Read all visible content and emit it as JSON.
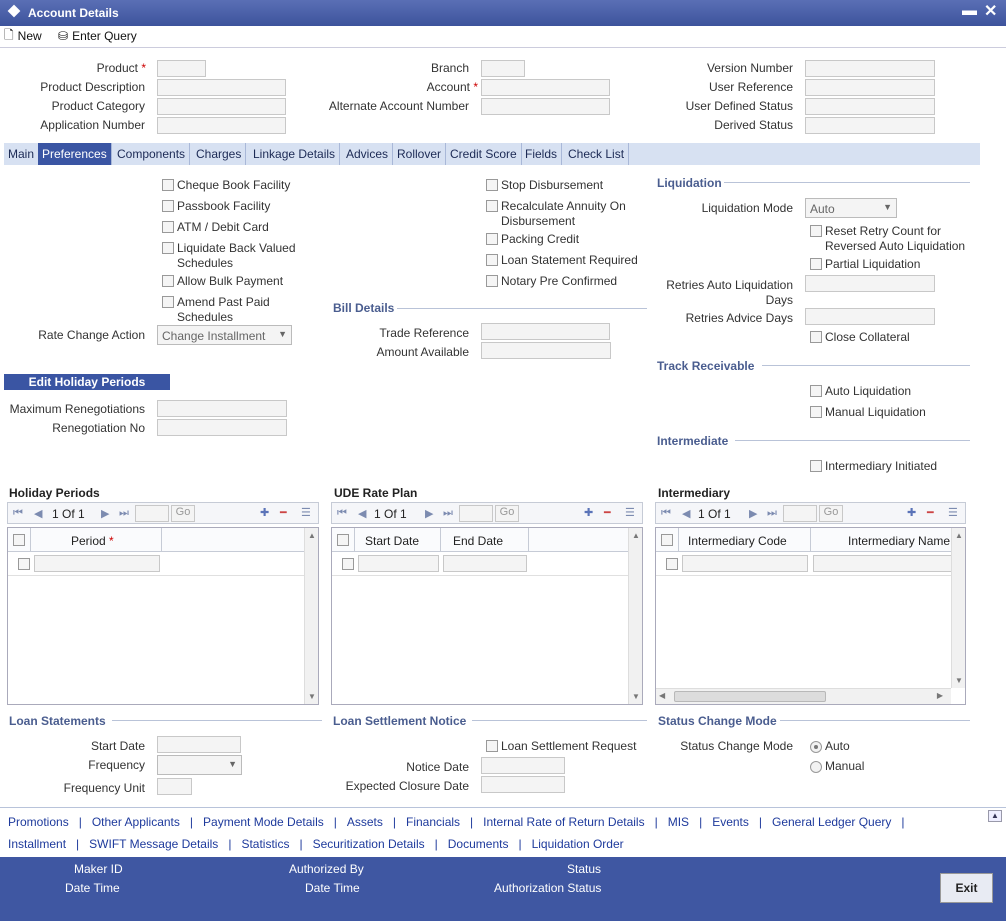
{
  "window": {
    "title": "Account Details"
  },
  "toolbar": {
    "new_label": "New",
    "enter_query_label": "Enter Query"
  },
  "header": {
    "product": "Product",
    "product_description": "Product Description",
    "product_category": "Product Category",
    "application_number": "Application Number",
    "branch": "Branch",
    "account": "Account",
    "alternate_account_number": "Alternate Account Number",
    "version_number": "Version Number",
    "user_reference": "User Reference",
    "user_defined_status": "User Defined Status",
    "derived_status": "Derived Status",
    "required_mark": "*"
  },
  "tabs": [
    "Main",
    "Preferences",
    "Components",
    "Charges",
    "Linkage Details",
    "Advices",
    "Rollover",
    "Credit Score",
    "Fields",
    "Check List"
  ],
  "prefs": {
    "col1": [
      "Cheque Book Facility",
      "Passbook Facility",
      "ATM / Debit Card",
      "Liquidate Back Valued",
      "Schedules",
      "Allow Bulk Payment",
      "Amend Past Paid",
      "Schedules"
    ],
    "rate_change_action_label": "Rate Change Action",
    "rate_change_action_value": "Change Installment",
    "col2": [
      "Stop Disbursement",
      "Recalculate Annuity On",
      "Disbursement",
      "Packing Credit",
      "Loan Statement Required",
      "Notary Pre Confirmed"
    ],
    "bill_details": "Bill Details",
    "trade_reference": "Trade Reference",
    "amount_available": "Amount Available",
    "edit_holiday_periods": "Edit Holiday Periods",
    "maximum_renegotiations": "Maximum Renegotiations",
    "renegotiation_no": "Renegotiation No"
  },
  "liquidation": {
    "title": "Liquidation",
    "mode_label": "Liquidation Mode",
    "mode_value": "Auto",
    "reset_retry": "Reset Retry Count for",
    "reversed_auto": "Reversed Auto Liquidation",
    "partial": "Partial Liquidation",
    "retries_auto": "Retries Auto Liquidation",
    "days": "Days",
    "retries_advice": "Retries Advice Days",
    "close_collateral": "Close Collateral"
  },
  "track": {
    "title": "Track Receivable",
    "auto": "Auto Liquidation",
    "manual": "Manual Liquidation"
  },
  "intermediate": {
    "title": "Intermediate",
    "initiated": "Intermediary Initiated"
  },
  "grids": {
    "holiday": {
      "title": "Holiday Periods",
      "page": "1 Of 1",
      "go": "Go",
      "col1": "Period"
    },
    "ude": {
      "title": "UDE Rate Plan",
      "page": "1 Of 1",
      "go": "Go",
      "col1": "Start Date",
      "col2": "End Date"
    },
    "inter": {
      "title": "Intermediary",
      "page": "1 Of 1",
      "go": "Go",
      "col1": "Intermediary Code",
      "col2": "Intermediary Name"
    }
  },
  "loan_statements": {
    "title": "Loan Statements",
    "start_date": "Start Date",
    "frequency": "Frequency",
    "frequency_unit": "Frequency Unit"
  },
  "settlement": {
    "title": "Loan Settlement Notice",
    "request": "Loan Settlement Request",
    "notice_date": "Notice Date",
    "expected_closure": "Expected Closure Date"
  },
  "status_change": {
    "title": "Status Change Mode",
    "label": "Status Change Mode",
    "auto": "Auto",
    "manual": "Manual"
  },
  "links_row1": [
    "Promotions",
    "Other Applicants",
    "Payment Mode Details",
    "Assets",
    "Financials",
    "Internal Rate of Return Details",
    "MIS",
    "Events",
    "General Ledger Query"
  ],
  "links_row2": [
    "Installment",
    "SWIFT Message Details",
    "Statistics",
    "Securitization Details",
    "Documents",
    "Liquidation Order"
  ],
  "link_separator": "|",
  "footer": {
    "maker_id": "Maker ID",
    "date_time": "Date Time",
    "authorized_by": "Authorized By",
    "date_time2": "Date Time",
    "status": "Status",
    "authorization_status": "Authorization Status",
    "exit": "Exit"
  }
}
